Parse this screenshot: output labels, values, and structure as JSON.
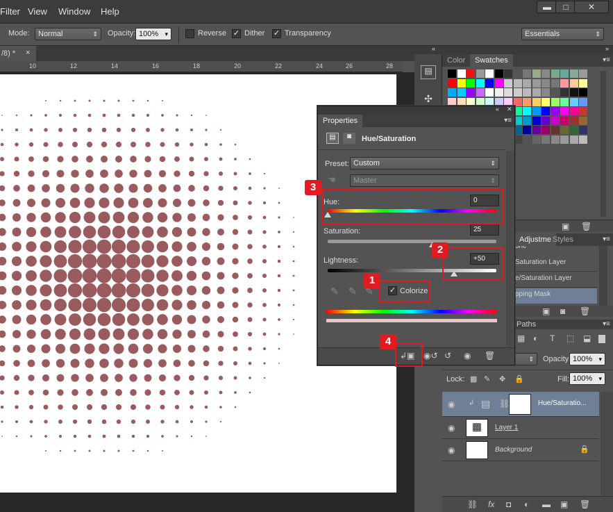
{
  "menu": [
    "Filter",
    "View",
    "Window",
    "Help"
  ],
  "window_controls": {
    "minimize": "▬",
    "restore": "□",
    "close": "✕"
  },
  "options": {
    "mode_label": "Mode:",
    "mode_value": "Normal",
    "opacity_label": "Opacity:",
    "opacity_value": "100%",
    "reverse_label": "Reverse",
    "dither_label": "Dither",
    "transparency_label": "Transparency",
    "workspace": "Essentials"
  },
  "document": {
    "tab_title": "/8) *",
    "close": "×"
  },
  "ruler_ticks": [
    "10",
    "12",
    "14",
    "16",
    "18",
    "20",
    "22",
    "24",
    "26",
    "28"
  ],
  "swatches_panel": {
    "tabs": [
      "Color",
      "Swatches"
    ]
  },
  "properties": {
    "panel_title": "Properties",
    "adjustment_name": "Hue/Saturation",
    "preset_label": "Preset:",
    "preset_value": "Custom",
    "channel_value": "Master",
    "hue_label": "Hue:",
    "hue_value": "0",
    "hue_pct": 0.0,
    "saturation_label": "Saturation:",
    "saturation_value": "25",
    "saturation_pct": 0.62,
    "lightness_label": "Lightness:",
    "lightness_value": "+50",
    "lightness_pct": 0.75,
    "colorize_label": "Colorize",
    "colorize_checked": true
  },
  "adjust_panel": {
    "tabs": [
      "Adjustme",
      "Styles"
    ],
    "items": [
      "one",
      "Saturation Layer",
      "e/Saturation Layer",
      "pping Mask"
    ]
  },
  "paths_tab": "Paths",
  "layers": {
    "opacity_label": "Opacity:",
    "opacity_value": "100%",
    "lock_label": "Lock:",
    "fill_label": "Fill:",
    "fill_value": "100%",
    "rows": [
      {
        "name": "Hue/Saturatio...",
        "selected": true
      },
      {
        "name": "Layer 1",
        "selected": false
      },
      {
        "name": "Background",
        "selected": false
      }
    ]
  },
  "annotations": [
    "1",
    "2",
    "3",
    "4"
  ],
  "colors": {
    "halftone_dot": "#9a5b5f",
    "annotation_red": "#e11b22",
    "selected_row": "#6f7f96"
  }
}
